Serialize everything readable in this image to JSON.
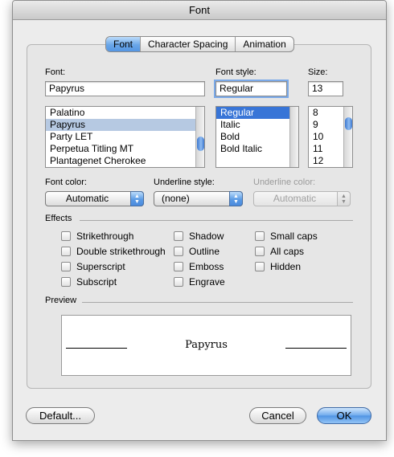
{
  "window": {
    "title": "Font"
  },
  "tabs": [
    {
      "label": "Font",
      "selected": true
    },
    {
      "label": "Character Spacing",
      "selected": false
    },
    {
      "label": "Animation",
      "selected": false
    }
  ],
  "font": {
    "label": "Font:",
    "value": "Papyrus",
    "list": [
      "Palatino",
      "Papyrus",
      "Party LET",
      "Perpetua Titling MT",
      "Plantagenet Cherokee"
    ],
    "selected_index": 1
  },
  "font_style": {
    "label": "Font style:",
    "value": "Regular",
    "list": [
      "Regular",
      "Italic",
      "Bold",
      "Bold Italic"
    ],
    "selected_index": 0
  },
  "size": {
    "label": "Size:",
    "value": "13",
    "list": [
      "8",
      "9",
      "10",
      "11",
      "12"
    ]
  },
  "font_color": {
    "label": "Font color:",
    "value": "Automatic"
  },
  "underline_style": {
    "label": "Underline style:",
    "value": "(none)"
  },
  "underline_color": {
    "label": "Underline color:",
    "value": "Automatic"
  },
  "effects": {
    "label": "Effects",
    "col1": [
      "Strikethrough",
      "Double strikethrough",
      "Superscript",
      "Subscript"
    ],
    "col2": [
      "Shadow",
      "Outline",
      "Emboss",
      "Engrave"
    ],
    "col3": [
      "Small caps",
      "All caps",
      "Hidden"
    ]
  },
  "preview": {
    "label": "Preview",
    "sample": "Papyrus"
  },
  "buttons": {
    "default": "Default...",
    "cancel": "Cancel",
    "ok": "OK"
  },
  "colors": {
    "accent": "#3875d7",
    "window_bg": "#ececec"
  }
}
